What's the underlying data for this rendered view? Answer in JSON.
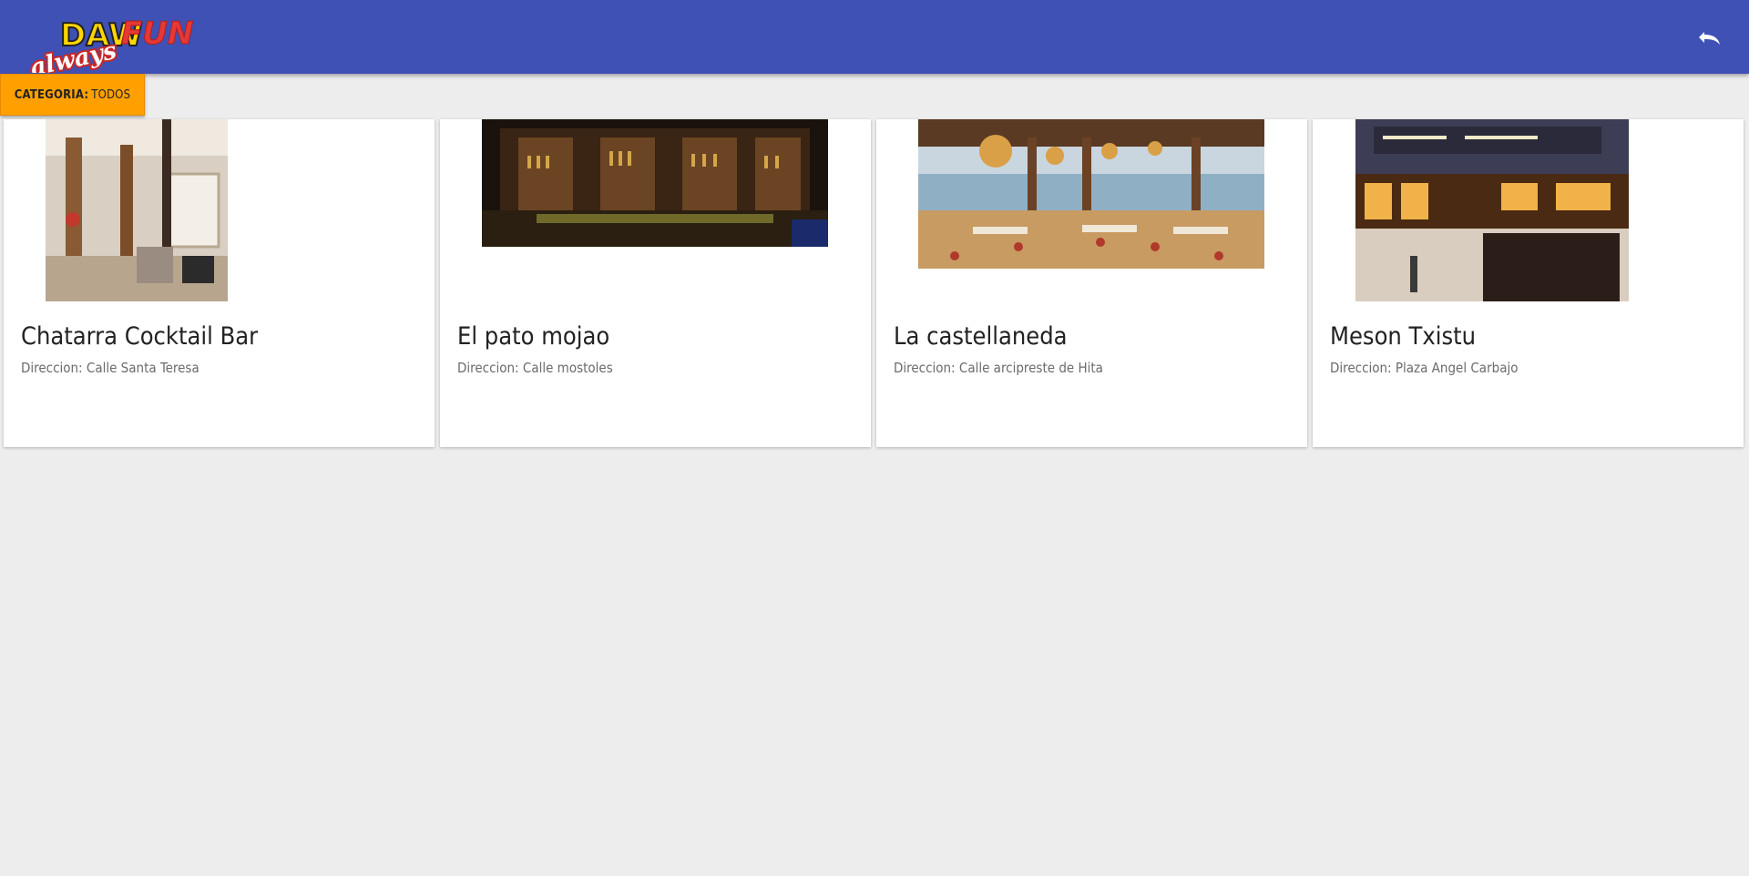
{
  "header": {
    "logo_text_top": "DAW",
    "logo_text_fun": "FUN",
    "logo_text_script": "always",
    "undo_icon": "undo-icon",
    "colors": {
      "bar": "#3f51b5"
    }
  },
  "filter": {
    "label": "CATEGORIA:",
    "value": "TODOS",
    "color": "#ffa000"
  },
  "venues": [
    {
      "name": "Chatarra Cocktail Bar",
      "address": "Direccion: Calle Santa Teresa"
    },
    {
      "name": "El pato mojao",
      "address": "Direccion: Calle mostoles"
    },
    {
      "name": "La castellaneda",
      "address": "Direccion: Calle arcipreste de Hita"
    },
    {
      "name": "Meson Txistu",
      "address": "Direccion: Plaza Angel Carbajo"
    }
  ]
}
